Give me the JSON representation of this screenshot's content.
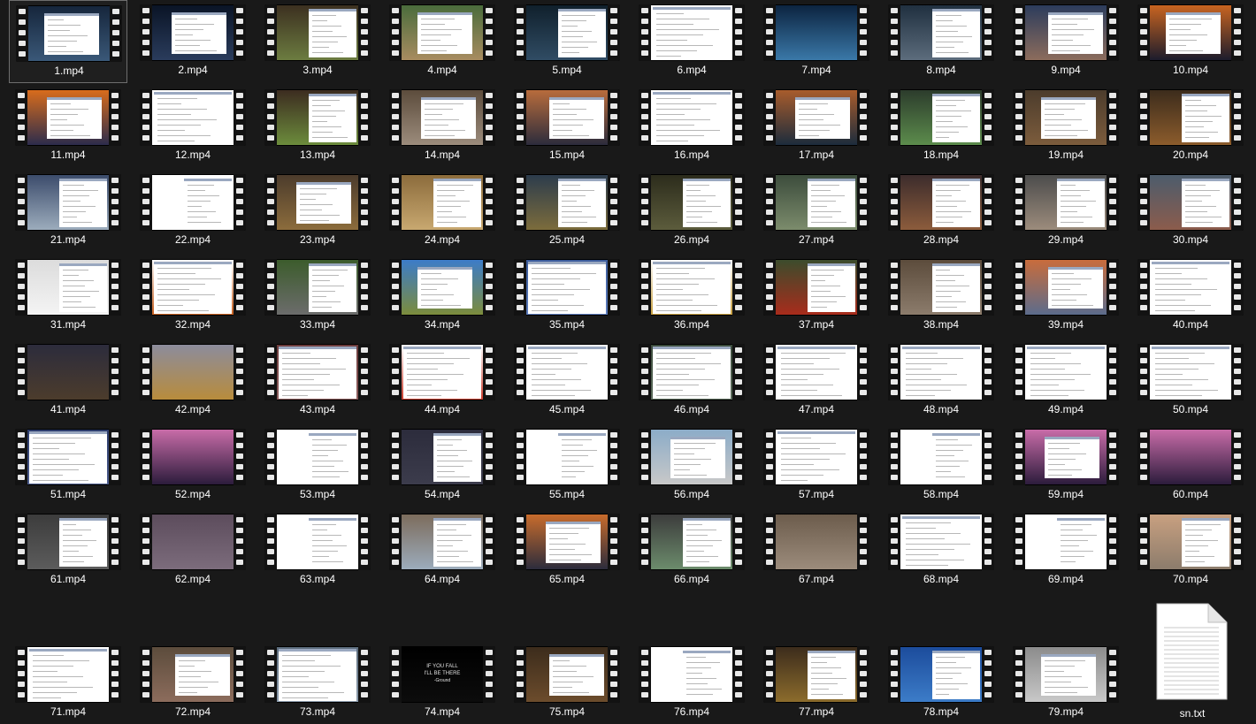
{
  "folder_view": {
    "selected_index": 0,
    "items": [
      {
        "name": "1.mp4",
        "type": "video",
        "thumb": "desktop-window",
        "bg": [
          "#16263c",
          "#3a5878"
        ],
        "win": "white"
      },
      {
        "name": "2.mp4",
        "type": "video",
        "thumb": "night-sky-moon",
        "bg": [
          "#0a1426",
          "#2a3c5c"
        ],
        "win": "notepad"
      },
      {
        "name": "3.mp4",
        "type": "video",
        "thumb": "game-window",
        "bg": [
          "#3c3020",
          "#6c7c40"
        ],
        "win": "explorer"
      },
      {
        "name": "4.mp4",
        "type": "video",
        "thumb": "game-window",
        "bg": [
          "#4a6c3c",
          "#a88c60"
        ],
        "win": "notepad"
      },
      {
        "name": "5.mp4",
        "type": "video",
        "thumb": "desktop-window",
        "bg": [
          "#10202c",
          "#304c64"
        ],
        "win": "explorer"
      },
      {
        "name": "6.mp4",
        "type": "video",
        "thumb": "document",
        "bg": [
          "#ffffff",
          "#ffffff"
        ],
        "win": "document"
      },
      {
        "name": "7.mp4",
        "type": "video",
        "thumb": "night-sky-moon",
        "bg": [
          "#0c2440",
          "#3a78a8"
        ],
        "win": "none"
      },
      {
        "name": "8.mp4",
        "type": "video",
        "thumb": "explorer",
        "bg": [
          "#203040",
          "#5c6c7c"
        ],
        "win": "explorer"
      },
      {
        "name": "9.mp4",
        "type": "video",
        "thumb": "document",
        "bg": [
          "#2c3c5c",
          "#8c6c5c"
        ],
        "win": "notepad"
      },
      {
        "name": "10.mp4",
        "type": "video",
        "thumb": "sunset",
        "bg": [
          "#c86420",
          "#1c1c2c"
        ],
        "win": "notepad"
      },
      {
        "name": "11.mp4",
        "type": "video",
        "thumb": "sunset",
        "bg": [
          "#d86c1c",
          "#2c2c4c"
        ],
        "win": "notepad"
      },
      {
        "name": "12.mp4",
        "type": "video",
        "thumb": "document",
        "bg": [
          "#ffffff",
          "#ffffff"
        ],
        "win": "document"
      },
      {
        "name": "13.mp4",
        "type": "video",
        "thumb": "game-window",
        "bg": [
          "#3c2c20",
          "#6c8c3c"
        ],
        "win": "explorer"
      },
      {
        "name": "14.mp4",
        "type": "video",
        "thumb": "document",
        "bg": [
          "#5c4c3c",
          "#9c8c7c"
        ],
        "win": "notepad"
      },
      {
        "name": "15.mp4",
        "type": "video",
        "thumb": "sunset",
        "bg": [
          "#b86c3c",
          "#2c2c3c"
        ],
        "win": "notepad"
      },
      {
        "name": "16.mp4",
        "type": "video",
        "thumb": "document",
        "bg": [
          "#ffffff",
          "#ffffff"
        ],
        "win": "document"
      },
      {
        "name": "17.mp4",
        "type": "video",
        "thumb": "sunset",
        "bg": [
          "#a85c2c",
          "#1c2c3c"
        ],
        "win": "notepad"
      },
      {
        "name": "18.mp4",
        "type": "video",
        "thumb": "game-window",
        "bg": [
          "#2c3c2c",
          "#5c8c4c"
        ],
        "win": "explorer"
      },
      {
        "name": "19.mp4",
        "type": "video",
        "thumb": "desktop-window",
        "bg": [
          "#4c3c2c",
          "#7c5c3c"
        ],
        "win": "notepad"
      },
      {
        "name": "20.mp4",
        "type": "video",
        "thumb": "desktop-window",
        "bg": [
          "#3c2c1c",
          "#8c5c2c"
        ],
        "win": "explorer"
      },
      {
        "name": "21.mp4",
        "type": "video",
        "thumb": "explorer",
        "bg": [
          "#3c4c6c",
          "#9cacbc"
        ],
        "win": "explorer"
      },
      {
        "name": "22.mp4",
        "type": "video",
        "thumb": "document",
        "bg": [
          "#ffffff",
          "#ffffff"
        ],
        "win": "explorer"
      },
      {
        "name": "23.mp4",
        "type": "video",
        "thumb": "game-window",
        "bg": [
          "#4c3c2c",
          "#8c6c3c"
        ],
        "win": "notepad"
      },
      {
        "name": "24.mp4",
        "type": "video",
        "thumb": "game-window",
        "bg": [
          "#8c6c3c",
          "#c8a870"
        ],
        "win": "explorer"
      },
      {
        "name": "25.mp4",
        "type": "video",
        "thumb": "game-window",
        "bg": [
          "#2c3c4c",
          "#7c6c3c"
        ],
        "win": "explorer"
      },
      {
        "name": "26.mp4",
        "type": "video",
        "thumb": "game-window",
        "bg": [
          "#2c2c1c",
          "#5c5c3c"
        ],
        "win": "explorer"
      },
      {
        "name": "27.mp4",
        "type": "video",
        "thumb": "game-window",
        "bg": [
          "#3c4c3c",
          "#7c8c6c"
        ],
        "win": "explorer"
      },
      {
        "name": "28.mp4",
        "type": "video",
        "thumb": "game-window",
        "bg": [
          "#3c2c2c",
          "#8c5c3c"
        ],
        "win": "explorer"
      },
      {
        "name": "29.mp4",
        "type": "video",
        "thumb": "explorer",
        "bg": [
          "#4c4c4c",
          "#9c8c7c"
        ],
        "win": "explorer"
      },
      {
        "name": "30.mp4",
        "type": "video",
        "thumb": "game-window",
        "bg": [
          "#4c5c6c",
          "#8c5c4c"
        ],
        "win": "explorer"
      },
      {
        "name": "31.mp4",
        "type": "video",
        "thumb": "explorer",
        "bg": [
          "#dcdcdc",
          "#f4f4f4"
        ],
        "win": "explorer"
      },
      {
        "name": "32.mp4",
        "type": "video",
        "thumb": "sunset",
        "bg": [
          "#ffffff",
          "#c86020"
        ],
        "win": "document"
      },
      {
        "name": "33.mp4",
        "type": "video",
        "thumb": "explorer",
        "bg": [
          "#3c5c2c",
          "#6c6c6c"
        ],
        "win": "explorer"
      },
      {
        "name": "34.mp4",
        "type": "video",
        "thumb": "landscape",
        "bg": [
          "#3c7cc8",
          "#7c8c3c"
        ],
        "win": "notepad"
      },
      {
        "name": "35.mp4",
        "type": "video",
        "thumb": "document",
        "bg": [
          "#3c5c9c",
          "#5c7cbc"
        ],
        "win": "document"
      },
      {
        "name": "36.mp4",
        "type": "video",
        "thumb": "document",
        "bg": [
          "#ffffff",
          "#c8a040"
        ],
        "win": "document"
      },
      {
        "name": "37.mp4",
        "type": "video",
        "thumb": "game-window",
        "bg": [
          "#3c4c2c",
          "#a82c1c"
        ],
        "win": "explorer"
      },
      {
        "name": "38.mp4",
        "type": "video",
        "thumb": "explorer",
        "bg": [
          "#5c4c3c",
          "#8c7c6c"
        ],
        "win": "explorer"
      },
      {
        "name": "39.mp4",
        "type": "video",
        "thumb": "sunset",
        "bg": [
          "#c86c3c",
          "#5c6c8c"
        ],
        "win": "notepad"
      },
      {
        "name": "40.mp4",
        "type": "video",
        "thumb": "browser",
        "bg": [
          "#ffffff",
          "#ffffff"
        ],
        "win": "document"
      },
      {
        "name": "41.mp4",
        "type": "video",
        "thumb": "landscape",
        "bg": [
          "#2c2c3c",
          "#4c3c2c"
        ],
        "win": "none"
      },
      {
        "name": "42.mp4",
        "type": "video",
        "thumb": "landscape",
        "bg": [
          "#8c8c9c",
          "#b88c3c"
        ],
        "win": "none"
      },
      {
        "name": "43.mp4",
        "type": "video",
        "thumb": "document",
        "bg": [
          "#6c3c3c",
          "#8c5c5c"
        ],
        "win": "document"
      },
      {
        "name": "44.mp4",
        "type": "video",
        "thumb": "document",
        "bg": [
          "#ffffff",
          "#c83c2c"
        ],
        "win": "document"
      },
      {
        "name": "45.mp4",
        "type": "video",
        "thumb": "document",
        "bg": [
          "#ffffff",
          "#ffffff"
        ],
        "win": "document"
      },
      {
        "name": "46.mp4",
        "type": "video",
        "thumb": "document",
        "bg": [
          "#3c4c3c",
          "#5c6c5c"
        ],
        "win": "document"
      },
      {
        "name": "47.mp4",
        "type": "video",
        "thumb": "document",
        "bg": [
          "#ffffff",
          "#ffffff"
        ],
        "win": "document"
      },
      {
        "name": "48.mp4",
        "type": "video",
        "thumb": "document",
        "bg": [
          "#ffffff",
          "#ffffff"
        ],
        "win": "document"
      },
      {
        "name": "49.mp4",
        "type": "video",
        "thumb": "document",
        "bg": [
          "#ffffff",
          "#ffffff"
        ],
        "win": "document"
      },
      {
        "name": "50.mp4",
        "type": "video",
        "thumb": "document",
        "bg": [
          "#ffffff",
          "#ffffff"
        ],
        "win": "document"
      },
      {
        "name": "51.mp4",
        "type": "video",
        "thumb": "document",
        "bg": [
          "#2c3c6c",
          "#4c5c8c"
        ],
        "win": "document"
      },
      {
        "name": "52.mp4",
        "type": "video",
        "thumb": "pyramid",
        "bg": [
          "#c86ca8",
          "#2c1c3c"
        ],
        "win": "none"
      },
      {
        "name": "53.mp4",
        "type": "video",
        "thumb": "explorer",
        "bg": [
          "#ffffff",
          "#ffffff"
        ],
        "win": "explorer"
      },
      {
        "name": "54.mp4",
        "type": "video",
        "thumb": "code-editor",
        "bg": [
          "#2c2c3c",
          "#3c3c4c"
        ],
        "win": "explorer"
      },
      {
        "name": "55.mp4",
        "type": "video",
        "thumb": "explorer",
        "bg": [
          "#ffffff",
          "#ffffff"
        ],
        "win": "explorer"
      },
      {
        "name": "56.mp4",
        "type": "video",
        "thumb": "desktop-window",
        "bg": [
          "#8cacc8",
          "#c8c8c8"
        ],
        "win": "notepad"
      },
      {
        "name": "57.mp4",
        "type": "video",
        "thumb": "document",
        "bg": [
          "#ffffff",
          "#ffffff"
        ],
        "win": "document"
      },
      {
        "name": "58.mp4",
        "type": "video",
        "thumb": "document",
        "bg": [
          "#ffffff",
          "#ffffff"
        ],
        "win": "explorer"
      },
      {
        "name": "59.mp4",
        "type": "video",
        "thumb": "pyramid",
        "bg": [
          "#c86ca8",
          "#2c1c3c"
        ],
        "win": "notepad"
      },
      {
        "name": "60.mp4",
        "type": "video",
        "thumb": "pyramid",
        "bg": [
          "#c86ca8",
          "#2c1c3c"
        ],
        "win": "none"
      },
      {
        "name": "61.mp4",
        "type": "video",
        "thumb": "explorer",
        "bg": [
          "#3c3c3c",
          "#5c5c5c"
        ],
        "win": "explorer"
      },
      {
        "name": "62.mp4",
        "type": "video",
        "thumb": "game-window",
        "bg": [
          "#5c4c5c",
          "#7c6c7c"
        ],
        "win": "none"
      },
      {
        "name": "63.mp4",
        "type": "video",
        "thumb": "document",
        "bg": [
          "#ffffff",
          "#ffffff"
        ],
        "win": "explorer"
      },
      {
        "name": "64.mp4",
        "type": "video",
        "thumb": "desktop-window",
        "bg": [
          "#7c6c5c",
          "#9cacbc"
        ],
        "win": "explorer"
      },
      {
        "name": "65.mp4",
        "type": "video",
        "thumb": "sunset",
        "bg": [
          "#c86c2c",
          "#2c2c3c"
        ],
        "win": "notepad"
      },
      {
        "name": "66.mp4",
        "type": "video",
        "thumb": "explorer",
        "bg": [
          "#3c3c3c",
          "#6c8c6c"
        ],
        "win": "explorer"
      },
      {
        "name": "67.mp4",
        "type": "video",
        "thumb": "game-window",
        "bg": [
          "#6c5c4c",
          "#9c8c7c"
        ],
        "win": "none"
      },
      {
        "name": "68.mp4",
        "type": "video",
        "thumb": "browser",
        "bg": [
          "#ffffff",
          "#ffffff"
        ],
        "win": "document"
      },
      {
        "name": "69.mp4",
        "type": "video",
        "thumb": "explorer",
        "bg": [
          "#ffffff",
          "#ffffff"
        ],
        "win": "explorer"
      },
      {
        "name": "70.mp4",
        "type": "video",
        "thumb": "explorer",
        "bg": [
          "#c8a080",
          "#8c7c6c"
        ],
        "win": "explorer"
      },
      {
        "name": "71.mp4",
        "type": "video",
        "thumb": "document",
        "bg": [
          "#ffffff",
          "#ffffff"
        ],
        "win": "document"
      },
      {
        "name": "72.mp4",
        "type": "video",
        "thumb": "game-window",
        "bg": [
          "#5c4c3c",
          "#8c6c5c"
        ],
        "win": "notepad"
      },
      {
        "name": "73.mp4",
        "type": "video",
        "thumb": "document",
        "bg": [
          "#5c6c7c",
          "#8c9cac"
        ],
        "win": "document"
      },
      {
        "name": "74.mp4",
        "type": "video",
        "thumb": "dark-quote",
        "bg": [
          "#000000",
          "#0c0c0c"
        ],
        "win": "none",
        "text": [
          "IF YOU FALL",
          "I'LL BE THERE",
          "-Ground"
        ]
      },
      {
        "name": "75.mp4",
        "type": "video",
        "thumb": "desktop-window",
        "bg": [
          "#3c2c1c",
          "#6c4c2c"
        ],
        "win": "notepad"
      },
      {
        "name": "76.mp4",
        "type": "video",
        "thumb": "explorer",
        "bg": [
          "#ffffff",
          "#ffffff"
        ],
        "win": "explorer"
      },
      {
        "name": "77.mp4",
        "type": "video",
        "thumb": "game-window",
        "bg": [
          "#3c2c1c",
          "#8c6c2c"
        ],
        "win": "explorer"
      },
      {
        "name": "78.mp4",
        "type": "video",
        "thumb": "explorer",
        "bg": [
          "#1c4c9c",
          "#3c7cc8"
        ],
        "win": "explorer"
      },
      {
        "name": "79.mp4",
        "type": "video",
        "thumb": "desktop-window",
        "bg": [
          "#8c8c8c",
          "#c8c8c8"
        ],
        "win": "notepad"
      },
      {
        "name": "sn.txt",
        "type": "text",
        "thumb": "text-file-icon"
      }
    ]
  }
}
